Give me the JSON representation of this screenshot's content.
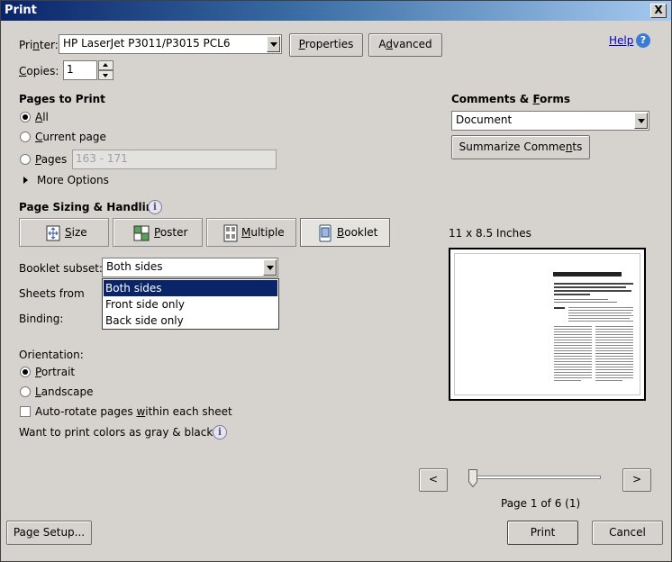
{
  "window": {
    "title": "Print",
    "close_glyph": "X"
  },
  "printer": {
    "label_pre": "Pri",
    "label_key": "n",
    "label_post": "ter:",
    "value": "HP LaserJet P3011/P3015 PCL6",
    "properties_pre": "",
    "properties_key": "P",
    "properties_post": "roperties",
    "advanced_pre": "A",
    "advanced_key": "d",
    "advanced_post": "vanced"
  },
  "help": {
    "label": "Help",
    "icon_glyph": "?"
  },
  "copies": {
    "label_key": "C",
    "label_post": "opies:",
    "value": "1"
  },
  "pages_to_print": {
    "header": "Pages to Print",
    "options": [
      {
        "key": "A",
        "rest": "ll",
        "selected": true
      },
      {
        "key": "C",
        "rest": "urrent page",
        "selected": false
      },
      {
        "key": "P",
        "rest": "ages",
        "selected": false
      }
    ],
    "pages_range_placeholder": "163 - 171",
    "more_options": "More Options"
  },
  "comments_forms": {
    "header_pre": "Comments & ",
    "header_key": "F",
    "header_post": "orms",
    "value": "Document",
    "summarize_pre": "Summarize Comme",
    "summarize_key": "n",
    "summarize_post": "ts"
  },
  "page_sizing": {
    "header": "Page Sizing & Handling",
    "tabs": [
      {
        "label_key": "S",
        "label_rest": "ize",
        "icon": "size-icon",
        "active": false
      },
      {
        "label_key": "P",
        "label_rest": "oster",
        "icon": "poster-icon",
        "active": false
      },
      {
        "label_key": "M",
        "label_rest": "ultiple",
        "icon": "multiple-icon",
        "active": false
      },
      {
        "label_key": "B",
        "label_rest": "ooklet",
        "icon": "booklet-icon",
        "active": true
      }
    ]
  },
  "booklet": {
    "subset_label": "Booklet subset:",
    "subset_value": "Both sides",
    "subset_options": [
      "Both sides",
      "Front side only",
      "Back side only"
    ],
    "selected_option_index": 0,
    "sheets_from_label": "Sheets from",
    "binding_label": "Binding:"
  },
  "orientation": {
    "label": "Orientation:",
    "portrait_key": "P",
    "portrait_rest": "ortrait",
    "landscape_key": "L",
    "landscape_rest": "andscape",
    "selected": "portrait"
  },
  "auto_rotate": {
    "pre": "Auto-rotate pages ",
    "key": "w",
    "post": "ithin each sheet",
    "checked": false
  },
  "gray_question": "Want to print colors as gray & black?",
  "preview": {
    "size_label": "11 x 8.5 Inches",
    "prev_glyph": "<",
    "next_glyph": ">",
    "slider_fraction": 0,
    "page_indicator": "Page 1 of 6 (1)"
  },
  "footer": {
    "page_setup_pre": "Pa",
    "page_setup_key": "g",
    "page_setup_post": "e Setup...",
    "print_label": "Print",
    "cancel_label": "Cancel"
  },
  "colors": {
    "selection": "#0a246a",
    "link": "#0000cc",
    "titlebar_start": "#0a246a"
  }
}
